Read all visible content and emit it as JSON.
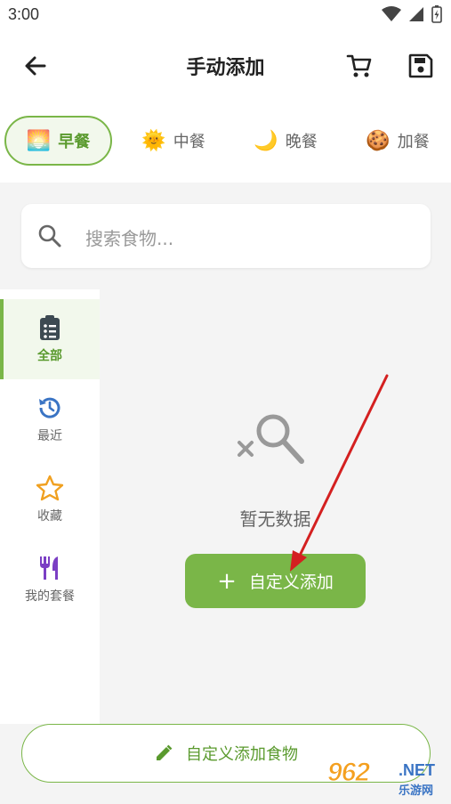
{
  "status_bar": {
    "time": "3:00"
  },
  "app_bar": {
    "title": "手动添加"
  },
  "meal_tabs": [
    {
      "emoji": "🌅",
      "label": "早餐",
      "active": true
    },
    {
      "emoji": "🌞",
      "label": "中餐",
      "active": false
    },
    {
      "emoji": "🌙",
      "label": "晚餐",
      "active": false
    },
    {
      "emoji": "🍪",
      "label": "加餐",
      "active": false
    }
  ],
  "search": {
    "placeholder": "搜索食物..."
  },
  "sidebar": {
    "items": [
      {
        "label": "全部",
        "icon": "clipboard-list-icon",
        "active": true
      },
      {
        "label": "最近",
        "icon": "history-icon",
        "active": false
      },
      {
        "label": "收藏",
        "icon": "star-icon",
        "active": false
      },
      {
        "label": "我的套餐",
        "icon": "fork-knife-icon",
        "active": false
      }
    ]
  },
  "empty_state": {
    "text": "暂无数据",
    "button_label": "自定义添加"
  },
  "bottom_button": {
    "label": "自定义添加食物"
  },
  "watermark": {
    "main": "962",
    "net": ".NET",
    "sub": "乐游网"
  },
  "colors": {
    "accent": "#7ab648",
    "accent_text": "#5a9a2e",
    "history_blue": "#3a74c4",
    "star_orange": "#f0a020",
    "fork_purple": "#7b3fc4",
    "arrow_red": "#d42020"
  }
}
